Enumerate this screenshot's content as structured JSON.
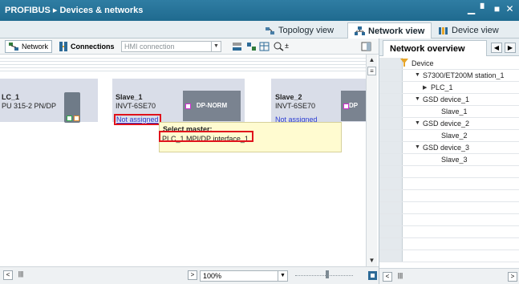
{
  "window": {
    "title": "PROFIBUS ▸ Devices & networks",
    "controls": [
      "minimize-icon",
      "restore-icon",
      "float-icon",
      "close-icon"
    ]
  },
  "view_tabs": [
    {
      "label": "Topology view",
      "active": false
    },
    {
      "label": "Network view",
      "active": true
    },
    {
      "label": "Device view",
      "active": false
    }
  ],
  "toolbar": {
    "network_label": "Network",
    "connections_label": "Connections",
    "connection_type_value": "HMI connection"
  },
  "canvas": {
    "devices": [
      {
        "name": "LC_1",
        "type": "PU 315-2 PN/DP"
      },
      {
        "name": "Slave_1",
        "type": "INVT-6SE70",
        "module": "DP-NORM",
        "link": "Not assigned"
      },
      {
        "name": "Slave_2",
        "type": "INVT-6SE70",
        "module": "DP",
        "link": "Not assigned"
      }
    ],
    "tooltip": {
      "label": "Select master:",
      "interface": "PLC_1.MPI/DP interface_1"
    }
  },
  "status": {
    "zoom": "100%"
  },
  "overview": {
    "tab_label": "Network overview",
    "header": "Device",
    "rows": [
      {
        "label": "S7300/ET200M station_1",
        "expanded": true,
        "indent": 1
      },
      {
        "label": "PLC_1",
        "expanded": false,
        "indent": 2
      },
      {
        "label": "GSD device_1",
        "expanded": true,
        "indent": 1
      },
      {
        "label": "Slave_1",
        "expanded": null,
        "indent": 2
      },
      {
        "label": "GSD device_2",
        "expanded": true,
        "indent": 1
      },
      {
        "label": "Slave_2",
        "expanded": null,
        "indent": 2
      },
      {
        "label": "GSD device_3",
        "expanded": true,
        "indent": 1
      },
      {
        "label": "Slave_3",
        "expanded": null,
        "indent": 2
      }
    ]
  },
  "colors": {
    "title_bar": "#1f6a8f",
    "highlight_frame": "#e0121b",
    "link_blue": "#2b3cd1",
    "port_magenta": "#d22fd2",
    "tooltip_bg": "#fffbd0"
  }
}
